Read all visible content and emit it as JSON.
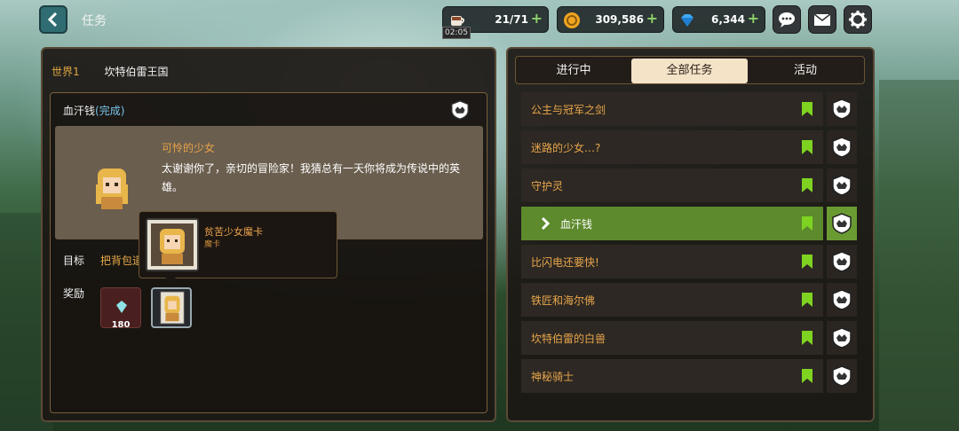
{
  "header": {
    "title": "任务",
    "stamina": "21/71",
    "stamina_timer": "02:05",
    "gold": "309,586",
    "gems": "6,344"
  },
  "left": {
    "world_label": "世界1",
    "kingdom": "坎特伯雷王国",
    "quest_name": "血汗钱",
    "quest_status": "(完成)",
    "npc_name": "可怜的少女",
    "npc_text": "太谢谢你了，亲切的冒险家！我猜总有一天你将成为传说中的英雄。",
    "goal_label": "目标",
    "goal_text": "把背包道",
    "reward_label": "奖励",
    "gem_reward_count": "180",
    "tooltip_name": "贫苦少女魔卡",
    "tooltip_type": "魔卡"
  },
  "tabs": [
    "进行中",
    "全部任务",
    "活动"
  ],
  "quests": [
    {
      "name": "公主与冠军之剑"
    },
    {
      "name": "迷路的少女…?"
    },
    {
      "name": "守护灵"
    },
    {
      "name": "血汗钱",
      "active": true
    },
    {
      "name": "比闪电还要快!"
    },
    {
      "name": "铁匠和海尔佛"
    },
    {
      "name": "坎特伯雷的白兽"
    },
    {
      "name": "神秘骑士"
    }
  ],
  "colors": {
    "accent_orange": "#e8a64b",
    "active_green": "#5d8a2c",
    "bookmark_green": "#7ed321"
  }
}
